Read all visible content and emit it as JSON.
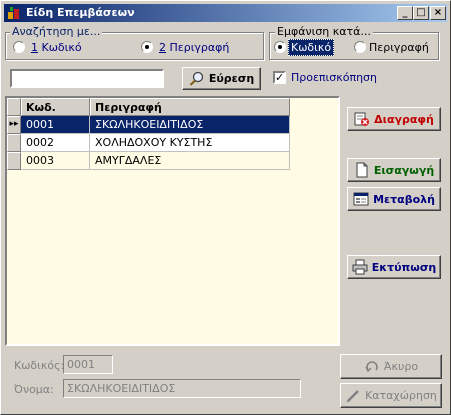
{
  "window": {
    "title": "Είδη Επεμβάσεων",
    "min": "_",
    "max": "□",
    "close": "×"
  },
  "search_group": {
    "legend": "Αναζήτηση με...",
    "opt1_num": "1",
    "opt1_label": "Κωδικό",
    "opt2_num": "2",
    "opt2_label": "Περιγραφή",
    "selected": "opt2"
  },
  "display_group": {
    "legend": "Εμφάνιση κατά...",
    "opt1_label": "Κωδικό",
    "opt2_label": "Περιγραφή",
    "selected": "opt1"
  },
  "search": {
    "value": "",
    "button": "Εύρεση"
  },
  "preview": {
    "label": "Προεπισκόπηση",
    "checked": true
  },
  "grid": {
    "columns": [
      "Κωδ.",
      "Περιγραφή"
    ],
    "rows": [
      {
        "code": "0001",
        "desc": "ΣΚΩΛΗΚΟΕΙΔΙΤΙΔΟΣ",
        "selected": true
      },
      {
        "code": "0002",
        "desc": "ΧΟΛΗΔΟΧΟΥ ΚΥΣΤΗΣ",
        "selected": false
      },
      {
        "code": "0003",
        "desc": "ΑΜΥΓΔΑΛΕΣ",
        "selected": false
      }
    ],
    "row_marker": "▸▸"
  },
  "actions": {
    "delete": "Διαγραφή",
    "insert": "Εισαγωγή",
    "edit": "Μεταβολή",
    "print": "Εκτύπωση",
    "cancel": "Άκυρο",
    "save": "Καταχώρηση"
  },
  "details": {
    "code_label": "Κωδικός:",
    "code_value": "0001",
    "name_label": "Όνομα:",
    "name_value": "ΣΚΩΛΗΚΟΕΙΔΙΤΙΔΟΣ"
  },
  "colors": {
    "title_bar": "#0a246a",
    "selection": "#0a246a",
    "delete_text": "#c00000",
    "insert_text": "#006000",
    "edit_text": "#000080",
    "print_text": "#000080"
  }
}
